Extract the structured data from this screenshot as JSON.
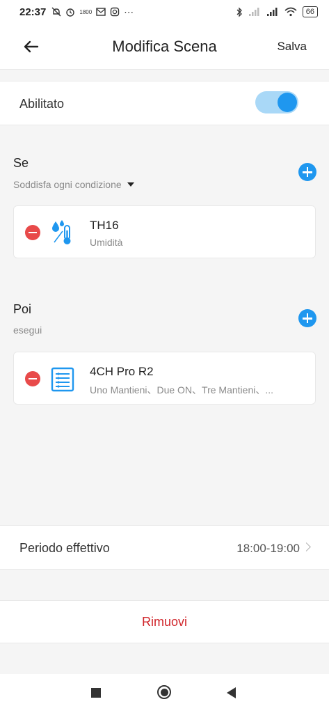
{
  "status_bar": {
    "time": "22:37",
    "battery": "66",
    "data_label": "1800"
  },
  "header": {
    "title": "Modifica Scena",
    "save_label": "Salva"
  },
  "enabled": {
    "label": "Abilitato",
    "on": true
  },
  "if_section": {
    "title": "Se",
    "subtitle": "Soddisfa ogni condizione",
    "items": [
      {
        "name": "TH16",
        "detail": "Umidità",
        "icon": "humidity-thermometer-icon"
      }
    ]
  },
  "then_section": {
    "title": "Poi",
    "subtitle": "esegui",
    "items": [
      {
        "name": "4CH Pro R2",
        "detail": "Uno Mantieni、Due ON、Tre Mantieni、...",
        "icon": "switch-panel-icon"
      }
    ]
  },
  "period": {
    "label": "Periodo effettivo",
    "value": "18:00-19:00"
  },
  "remove_label": "Rimuovi",
  "colors": {
    "accent": "#1f97ef",
    "danger": "#e84a4a",
    "remove_text": "#d0252b"
  }
}
